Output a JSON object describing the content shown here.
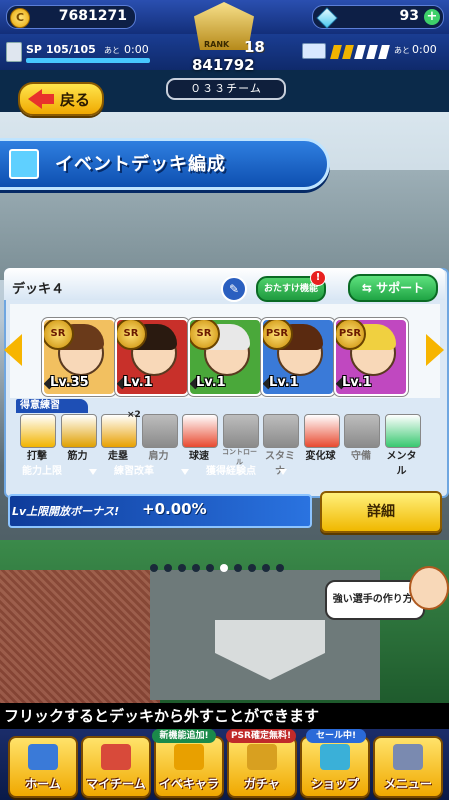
{
  "header": {
    "coins": "7681271",
    "gems": "93",
    "rank_word": "RANK",
    "rank_level": "18",
    "rank_points": "841792",
    "sp_text": "SP 105/105",
    "sp_suffix": "あと",
    "sp_time": "0:00",
    "stamina_suffix": "あと",
    "stamina_time": "0:00",
    "team_name": "０３３チーム"
  },
  "back_button": {
    "label": "戻る"
  },
  "title": "イベントデッキ編成",
  "deck": {
    "name": "デッキ４",
    "helper_label": "おたすけ機能",
    "helper_badge": "!",
    "support_label": "サポート",
    "cards": [
      {
        "rarity": "SR",
        "level": "Lv.35",
        "hair_color": "#6a3a1a",
        "bg": "#f2c060"
      },
      {
        "rarity": "SR",
        "level": "Lv.1",
        "hair_color": "#2a1a10",
        "bg": "#c8302a"
      },
      {
        "rarity": "SR",
        "level": "Lv.1",
        "hair_color": "#e8e8e8",
        "bg": "#4aa83a"
      },
      {
        "rarity": "PSR",
        "level": "Lv.1",
        "hair_color": "#5a2a10",
        "bg": "#3a7ad8"
      },
      {
        "rarity": "PSR",
        "level": "Lv.1",
        "hair_color": "#f0d040",
        "bg": "#c048c0"
      }
    ],
    "skills_header": "得意練習",
    "skills": [
      {
        "label": "打撃",
        "active": true,
        "color": "#f2b400",
        "icon": "bat-icon"
      },
      {
        "label": "筋力",
        "active": true,
        "color": "#e0a000",
        "icon": "dumbbell-icon"
      },
      {
        "label": "走塁",
        "active": true,
        "color": "#e8a000",
        "icon": "shoe-icon",
        "badge": "×2"
      },
      {
        "label": "肩力",
        "active": false,
        "color": "#8a8a8a",
        "icon": "arm-icon"
      },
      {
        "label": "球速",
        "active": true,
        "color": "#e84a30",
        "icon": "ball-icon"
      },
      {
        "label": "コントロール",
        "active": false,
        "color": "#8a8a8a",
        "icon": "target-icon"
      },
      {
        "label": "スタミナ",
        "active": false,
        "color": "#8a8a8a",
        "icon": "hat-icon"
      },
      {
        "label": "変化球",
        "active": true,
        "color": "#e84a30",
        "icon": "curve-ball-icon"
      },
      {
        "label": "守備",
        "active": false,
        "color": "#8a8a8a",
        "icon": "glove-icon"
      },
      {
        "label": "メンタル",
        "active": true,
        "color": "#38c870",
        "icon": "clover-icon"
      }
    ],
    "tabs": [
      {
        "label": "能力上限",
        "color": "#2f5fd0"
      },
      {
        "label": "練習改革",
        "color": "#7a3ed0"
      },
      {
        "label": "獲得経験点",
        "color": "#f0a800"
      }
    ],
    "bonus_label": "Lv上限開放ボーナス!",
    "bonus_value": "+0.00%",
    "detail_label": "詳細"
  },
  "pager": {
    "count": 10,
    "active_index": 6
  },
  "guide": {
    "label": "強い選手の作り方!"
  },
  "notice": "フリックするとデッキから外すことができます",
  "bottom_nav": {
    "items": [
      {
        "label": "ホーム",
        "icon": "home-icon"
      },
      {
        "label": "マイチーム",
        "icon": "team-icon"
      },
      {
        "label": "イベキャラ",
        "icon": "event-chara-icon"
      },
      {
        "label": "ガチャ",
        "icon": "gacha-icon"
      },
      {
        "label": "ショップ",
        "icon": "shop-icon"
      },
      {
        "label": "メニュー",
        "icon": "menu-icon"
      }
    ],
    "tags": {
      "event": "新機能追加!",
      "gacha": "PSR確定無料!",
      "shop": "セール中!"
    }
  }
}
